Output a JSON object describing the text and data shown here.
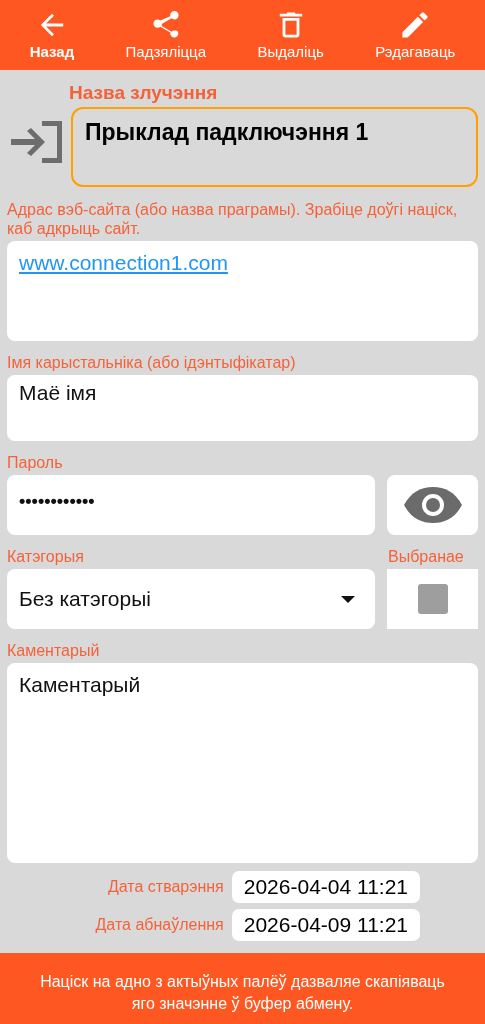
{
  "toolbar": [
    {
      "kind": "back",
      "label": "Назад",
      "selected": true
    },
    {
      "kind": "share",
      "label": "Падзяліцца",
      "selected": false
    },
    {
      "kind": "delete",
      "label": "Выдаліць",
      "selected": false
    },
    {
      "kind": "edit",
      "label": "Рэдагаваць",
      "selected": false
    }
  ],
  "name": {
    "label": "Назва злучэння",
    "value": "Прыклад падключэння 1",
    "focused": true
  },
  "url": {
    "label": "Адрас вэб-сайта (або назва праграмы). Зрабіце доўгі націск, каб адкрыць сайт.",
    "value": "www.connection1.com"
  },
  "username": {
    "label": "Імя карыстальніка (або ідэнтыфікатар)",
    "value": "Маё імя"
  },
  "password": {
    "label": "Пароль",
    "value": "••••••••••••"
  },
  "category": {
    "label": "Катэгорыя",
    "value": "Без катэгорыі"
  },
  "favorite": {
    "label": "Выбранае",
    "checked": false
  },
  "comment": {
    "label": "Каментарый",
    "value": "Каментарый"
  },
  "dates": [
    {
      "label": "Дата стварэння",
      "value": "2026-04-04 11:21"
    },
    {
      "label": "Дата абнаўлення",
      "value": "2026-04-09 11:21"
    }
  ],
  "footer": "Націск на адно з актыўных палёў дазваляе скапіяваць яго значэнне ў буфер абмену."
}
